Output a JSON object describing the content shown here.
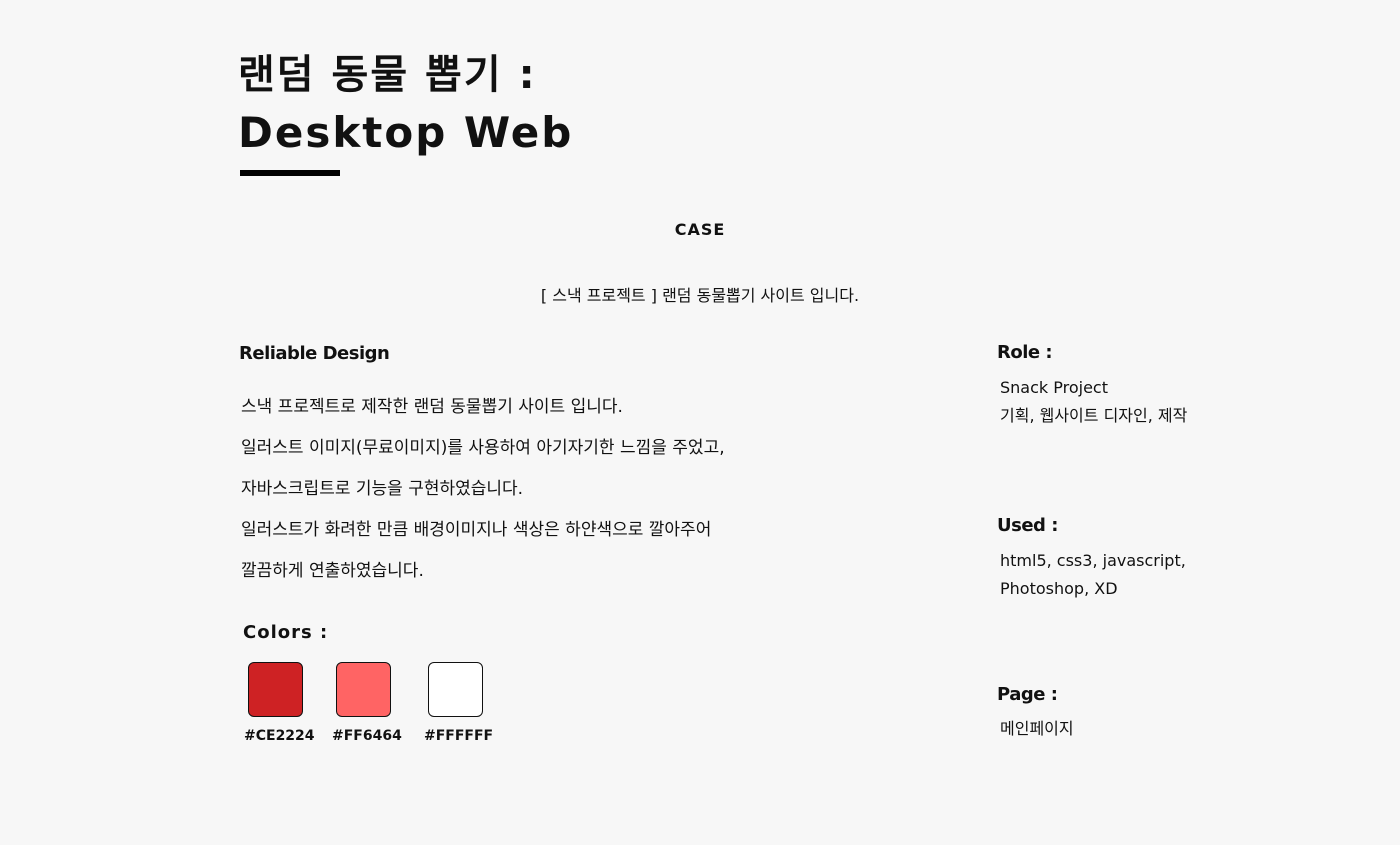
{
  "title_line1": "랜덤 동물 뽑기 :",
  "title_line2": "Desktop Web",
  "case_label": "CASE",
  "subtitle": "[ 스낵 프로젝트 ] 랜덤 동물뽑기 사이트 입니다.",
  "design_heading": "Reliable Design",
  "description": [
    "스낵 프로젝트로 제작한 랜덤 동물뽑기 사이트 입니다.",
    "일러스트 이미지(무료이미지)를 사용하여 아기자기한 느낌을 주었고,",
    "자바스크립트로 기능을 구현하였습니다.",
    "일러스트가 화려한 만큼 배경이미지나 색상은 하얀색으로 깔아주어",
    "깔끔하게 연출하였습니다."
  ],
  "colors_heading": "Colors :",
  "colors": [
    {
      "hex": "#CE2224",
      "label": "#CE2224"
    },
    {
      "hex": "#FF6464",
      "label": "#FF6464"
    },
    {
      "hex": "#FFFFFF",
      "label": "#FFFFFF"
    }
  ],
  "role": {
    "heading": "Role :",
    "lines": [
      "Snack Project",
      "기획, 웹사이트 디자인, 제작"
    ]
  },
  "used": {
    "heading": "Used :",
    "lines": [
      "html5, css3, javascript,",
      "Photoshop, XD"
    ]
  },
  "page": {
    "heading": "Page :",
    "lines": [
      "메인페이지"
    ]
  }
}
